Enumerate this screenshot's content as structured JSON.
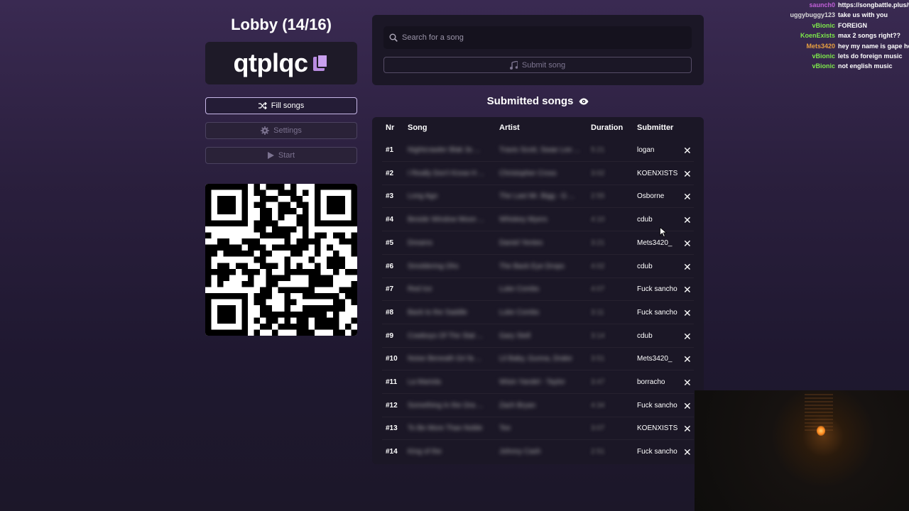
{
  "lobby": {
    "title": "Lobby (14/16)",
    "code": "qtplqc",
    "buttons": {
      "fill": "Fill songs",
      "settings": "Settings",
      "start": "Start"
    }
  },
  "search": {
    "placeholder": "Search for a song",
    "submit_label": "Submit song"
  },
  "submitted": {
    "title": "Submitted songs",
    "columns": {
      "nr": "Nr",
      "song": "Song",
      "artist": "Artist",
      "duration": "Duration",
      "submitter": "Submitter"
    },
    "rows": [
      {
        "nr": "#1",
        "song": "Nightcrawler Blak 3s ...",
        "artist": "Travis Scott, Swae Lee ...",
        "duration": "5:21",
        "submitter": "logan"
      },
      {
        "nr": "#2",
        "song": "I Really Don't Know H ...",
        "artist": "Christopher Cross",
        "duration": "3:02",
        "submitter": "KOENXISTS"
      },
      {
        "nr": "#3",
        "song": "Long Ago",
        "artist": "The Last Mr. Bigg - G ...",
        "duration": "2:55",
        "submitter": "Osborne"
      },
      {
        "nr": "#4",
        "song": "Beside Window Moon ...",
        "artist": "Whiskey Myers",
        "duration": "4:10",
        "submitter": "cdub"
      },
      {
        "nr": "#5",
        "song": "Dreams",
        "artist": "Daniel Yentes",
        "duration": "3:21",
        "submitter": "Mets3420_"
      },
      {
        "nr": "#6",
        "song": "Smoldering Ohs",
        "artist": "The Back Eye Drops",
        "duration": "4:02",
        "submitter": "cdub"
      },
      {
        "nr": "#7",
        "song": "Red Ice",
        "artist": "Luke Combs",
        "duration": "4:07",
        "submitter": "Fuck sancho"
      },
      {
        "nr": "#8",
        "song": "Back to the Saddle",
        "artist": "Luke Combs",
        "duration": "3:11",
        "submitter": "Fuck sancho"
      },
      {
        "nr": "#9",
        "song": "Cowboys Of The Stat ...",
        "artist": "Gary Stell",
        "duration": "3:14",
        "submitter": "cdub"
      },
      {
        "nr": "#10",
        "song": "Noise Beneath Gri fa ...",
        "artist": "Lil Baby, Gunna, Drake",
        "duration": "3:51",
        "submitter": "Mets3420_"
      },
      {
        "nr": "#11",
        "song": "La Mariola",
        "artist": "Wisin Yandel - Taylor",
        "duration": "3:47",
        "submitter": "borracho"
      },
      {
        "nr": "#12",
        "song": "Something In the Ora ...",
        "artist": "Zach Bryan",
        "duration": "4:34",
        "submitter": "Fuck sancho"
      },
      {
        "nr": "#13",
        "song": "To Be More Than Noble",
        "artist": "Tee",
        "duration": "3:07",
        "submitter": "KOENXISTS"
      },
      {
        "nr": "#14",
        "song": "King of the",
        "artist": "Johnny Cash",
        "duration": "2:51",
        "submitter": "Fuck sancho"
      }
    ],
    "remove_symbol": "✕"
  },
  "chat": [
    {
      "user": "saunch0",
      "color": "#c060d8",
      "msg": "https://songbattle.plus/t"
    },
    {
      "user": "uggybuggy123",
      "color": "#d8d8d8",
      "msg": "take us with you"
    },
    {
      "user": "vBionic",
      "color": "#7de84a",
      "msg": "FOREIGN"
    },
    {
      "user": "KoenExists",
      "color": "#7de84a",
      "msg": "max 2 songs right??"
    },
    {
      "user": "Mets3420",
      "color": "#e8a040",
      "msg": "hey my name is gape hor"
    },
    {
      "user": "vBionic",
      "color": "#7de84a",
      "msg": "lets do foreign music"
    },
    {
      "user": "vBionic",
      "color": "#7de84a",
      "msg": "not english music"
    }
  ],
  "colors": {
    "accent": "#c9a0ef",
    "background": "#2a1f3d",
    "panel": "#1b1726"
  },
  "icons": {
    "copy": "copy-icon",
    "shuffle": "shuffle-icon",
    "gear": "gear-icon",
    "play": "play-icon",
    "search": "search-icon",
    "music": "music-note-icon",
    "eye": "eye-icon",
    "close": "close-icon"
  }
}
